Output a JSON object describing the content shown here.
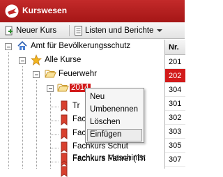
{
  "app": {
    "title": "Kurswesen"
  },
  "toolbar": {
    "new_course_label": "Neuer Kurs",
    "lists_reports_label": "Listen und Berichte"
  },
  "tree": {
    "root": "Amt für Bevölkerungsschutz",
    "all_courses": "Alle Kurse",
    "folder": "Feuerwehr",
    "selected_year": "2014",
    "children": [
      {
        "label": "Tr"
      },
      {
        "label": "Fachkurs 1 ("
      },
      {
        "label": "Fachkurs 1 ("
      },
      {
        "label": "Fachkurs Schut"
      },
      {
        "label": "Fachkurs Fahrer (Th"
      },
      {
        "label": "Fachkurs Maschinist"
      },
      {
        "label": ""
      }
    ]
  },
  "grid": {
    "header": "Nr.",
    "rows": [
      "201",
      "202",
      "304",
      "301",
      "302",
      "303",
      "305",
      "307",
      "308"
    ],
    "selected_index": 1
  },
  "context_menu": {
    "items": [
      "Neu",
      "Umbenennen",
      "Löschen",
      "Einfügen"
    ],
    "hover_index": 3
  },
  "colors": {
    "brand_red": "#c32a2a",
    "selection_red": "#d21a1a"
  }
}
